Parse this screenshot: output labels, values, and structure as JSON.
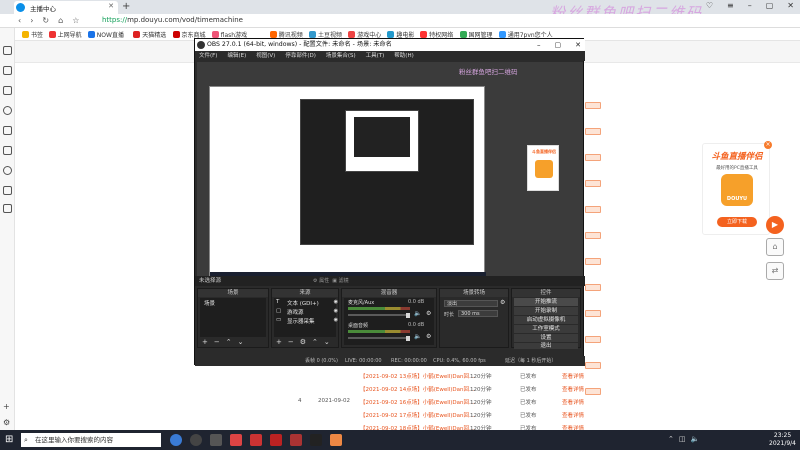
{
  "browser": {
    "tab_title": "主播中心",
    "url_protocol": "https://",
    "url_rest": "mp.douyu.com/vod/timemachine",
    "window_user": "开播中让我看播里里",
    "bookmarks": [
      "书签",
      "上网导航",
      "NOW直播",
      "天猫精选",
      "京东商城",
      "flash游戏",
      "腾讯视频",
      "土豆视频",
      "游戏中心",
      "趣电影",
      "特权网络",
      "国网管理",
      "通用7pvn您个人"
    ]
  },
  "watermark": {
    "main": "粉丝群鱼吧扫二维码",
    "small": "粉丝群鱼吧扫二维码"
  },
  "ad": {
    "title": "斗鱼直播伴侣",
    "subtitle": "最好用的PC直播工具",
    "logo_text": "DOUYU",
    "button": "立即下载",
    "close": "×"
  },
  "obs": {
    "title": "OBS 27.0.1 (64-bit, windows) - 配置文件: 未命名 - 场景: 未命名",
    "menu": [
      "文件(F)",
      "编辑(E)",
      "视图(V)",
      "停靠部件(D)",
      "场景集合(S)",
      "工具(T)",
      "帮助(H)"
    ],
    "source_bar_label": "未选择源",
    "source_bar_props": "⚙ 属性",
    "source_bar_filters": "▣ 滤镜",
    "docks": {
      "scenes": {
        "title": "场景",
        "items": [
          "场景"
        ]
      },
      "sources": {
        "title": "来源",
        "items": [
          {
            "icon": "T",
            "label": "文本 (GDI+)"
          },
          {
            "icon": "▢",
            "label": "游戏源"
          },
          {
            "icon": "▭",
            "label": "显示器采集"
          }
        ]
      },
      "mixer": {
        "title": "混音器",
        "channels": [
          {
            "name": "麦克风/Aux",
            "db": "0.0 dB"
          },
          {
            "name": "桌面音频",
            "db": "0.0 dB"
          }
        ]
      },
      "transitions": {
        "title": "场景转场",
        "type": "淡出",
        "duration_label": "时长",
        "duration": "300 ms"
      },
      "controls": {
        "title": "控件",
        "buttons": [
          "开始推流",
          "开始录制",
          "启动虚拟摄像机",
          "工作室模式",
          "设置",
          "退出"
        ]
      }
    },
    "status": {
      "dropped": "丢帧 0 (0.0%)",
      "live": "LIVE: 00:00:00",
      "rec": "REC: 00:00:00",
      "cpu": "CPU: 0.4%, 60.00 fps",
      "rec_hint": "延迟（每 1 秒后开始）"
    }
  },
  "bg_table": {
    "date": "2021-09-02",
    "rows": [
      {
        "link": "【2021-09-02 13点场】小鹤(Ewell)Dan回...",
        "dur": "120分钟",
        "status": "已发布",
        "action": "查看详情"
      },
      {
        "link": "【2021-09-02 14点场】小鹤(Ewell)Dan回...",
        "dur": "120分钟",
        "status": "已发布",
        "action": "查看详情"
      },
      {
        "link": "【2021-09-02 16点场】小鹤(Ewell)Dan回...",
        "dur": "120分钟",
        "status": "已发布",
        "action": "查看详情"
      },
      {
        "link": "【2021-09-02 17点场】小鹤(Ewell)Dan回...",
        "dur": "120分钟",
        "status": "已发布",
        "action": "查看详情"
      },
      {
        "link": "【2021-09-02 18点场】小鹤(Ewell)Dan回...",
        "dur": "120分钟",
        "status": "已发布",
        "action": "查看详情"
      }
    ],
    "row_index": "4"
  },
  "taskbar": {
    "search_placeholder": "在这里输入你要搜索的内容",
    "time": "23:25",
    "date": "2021/9/4"
  }
}
